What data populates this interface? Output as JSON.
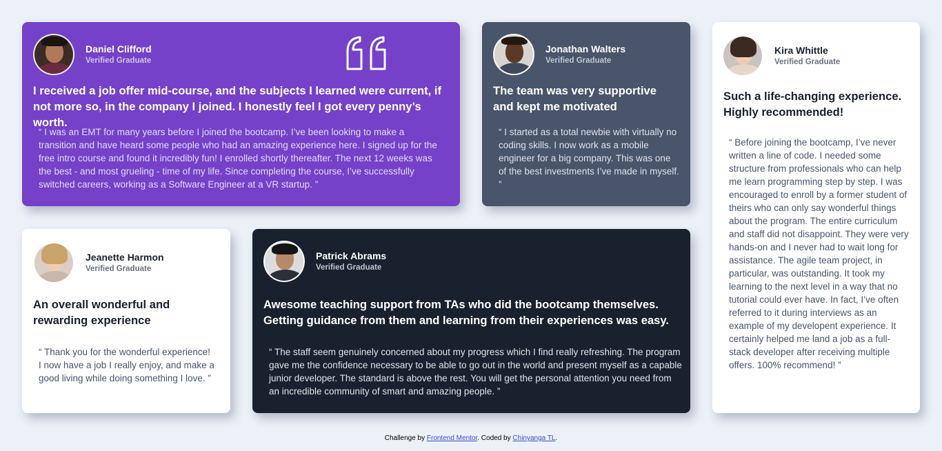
{
  "testimonials": {
    "daniel": {
      "name": "Daniel Clifford",
      "role": "Verified Graduate",
      "headline": "I received a job offer mid-course, and the subjects I learned were current, if not more so, in the company I joined. I honestly feel I got every penny’s worth.",
      "quote": "“ I was an EMT for many years before I joined the bootcamp. I’ve been looking to make a transition and have heard some people who had an amazing experience here. I signed up for the free intro course and found it incredibly fun! I enrolled shortly thereafter. The next 12 weeks was the best - and most grueling - time of my life. Since completing the course, I’ve successfully switched careers, working as a Software Engineer at a VR startup. ”",
      "background": "#7541c8"
    },
    "jonathan": {
      "name": "Jonathan Walters",
      "role": "Verified Graduate",
      "headline": "The team was very supportive and kept me motivated",
      "quote": "“ I started as a total newbie with virtually no coding skills. I now work as a mobile engineer for a big company. This was one of the best investments I’ve made in myself. ”",
      "background": "#48556a"
    },
    "kira": {
      "name": "Kira Whittle",
      "role": "Verified Graduate",
      "headline": "Such a life-changing experience. Highly recommended!",
      "quote": "“ Before joining the bootcamp, I’ve never written a line of code. I needed some structure from professionals who can help me learn programming step by step. I was encouraged to enroll by a former student of theirs who can only say wonderful things about the program. The entire curriculum and staff did not disappoint. They were very hands-on and I never had to wait long for assistance. The agile team project, in particular, was outstanding. It took my learning to the next level in a way that no tutorial could ever have. In fact, I’ve often referred to it during interviews as an example of my developent experience. It certainly helped me land a job as a full-stack developer after receiving multiple offers. 100% recommend! ”",
      "background": "#ffffff"
    },
    "jeanette": {
      "name": "Jeanette Harmon",
      "role": "Verified Graduate",
      "headline": "An overall wonderful and rewarding experience",
      "quote": "“ Thank you for the wonderful experience! I now have a job I really enjoy, and make a good living while doing something I love. ”",
      "background": "#ffffff"
    },
    "patrick": {
      "name": "Patrick Abrams",
      "role": "Verified Graduate",
      "headline": "Awesome teaching support from TAs who did the bootcamp themselves. Getting guidance from them and learning from their experiences was easy.",
      "quote": "“ The staff seem genuinely concerned about my progress which I find really refreshing. The program gave me the confidence necessary to be able to go out in the world and present myself as a capable junior developer. The standard is above the rest. You will get the personal attention you need from an incredible community of smart and amazing people. ”",
      "background": "#19212e"
    }
  },
  "footer": {
    "prefix": "Challenge by ",
    "link1": "Frontend Mentor",
    "middle": ". Coded by ",
    "link2": "Chinyanga TL",
    "suffix": "."
  },
  "icons": {
    "quote": "quote-icon"
  }
}
